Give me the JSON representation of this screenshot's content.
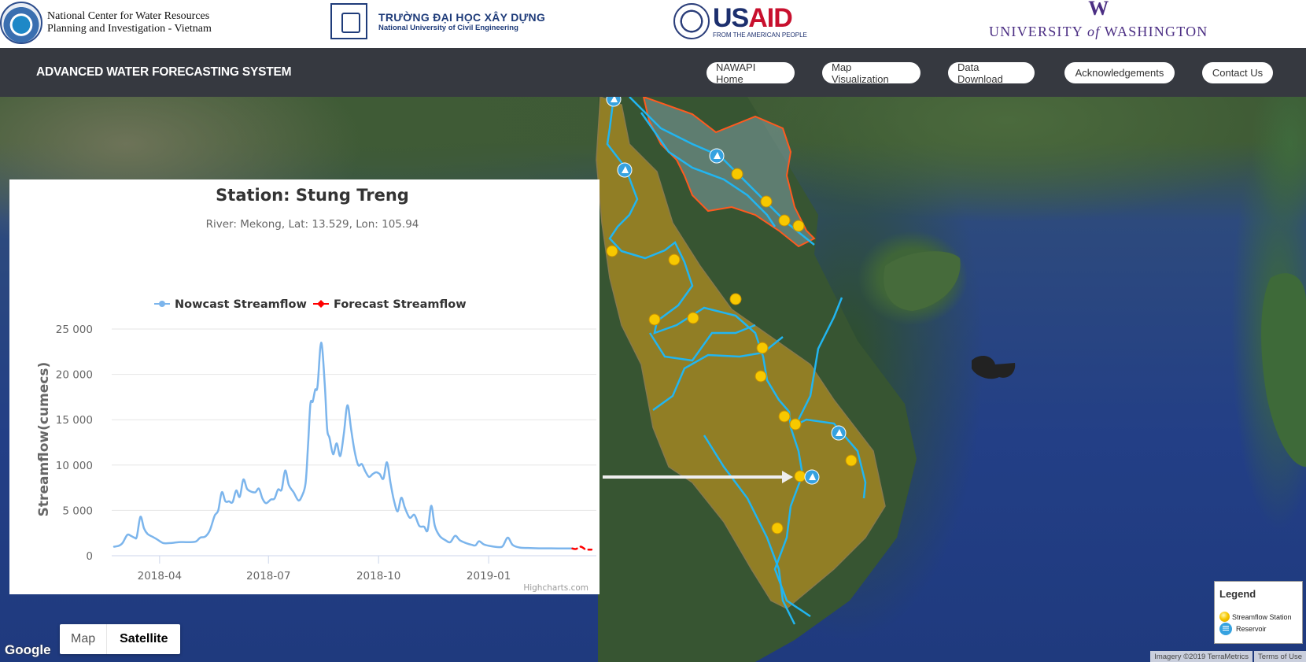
{
  "logos": {
    "nawapi": {
      "line1": "National Center for Water Resources",
      "line2": "Planning and Investigation - Vietnam"
    },
    "nuce": {
      "vn": "TRƯỜNG ĐẠI HỌC XÂY DỰNG",
      "en": "National University of Civil Engineering"
    },
    "usaid": {
      "us": "US",
      "aid": "AID",
      "tagline": "FROM THE AMERICAN PEOPLE"
    },
    "uw": {
      "mark": "W",
      "pre": "UNIVERSITY ",
      "of": "of",
      "post": " WASHINGTON"
    }
  },
  "navbar": {
    "title": "ADVANCED WATER FORECASTING SYSTEM",
    "links": [
      "NAWAPI Home",
      "Map Visualization",
      "Data Download",
      "Acknowledgements",
      "Contact Us"
    ]
  },
  "map": {
    "type_buttons": {
      "map": "Map",
      "satellite": "Satellite",
      "selected": "Satellite"
    },
    "google_label": "Google",
    "attribution": "Imagery ©2019 TerraMetrics",
    "terms": "Terms of Use",
    "legend": {
      "title": "Legend",
      "items": [
        {
          "icon": "streamflow-station-icon",
          "label": "Streamflow Station"
        },
        {
          "icon": "reservoir-icon",
          "label": "Reservoir"
        }
      ]
    },
    "colors": {
      "basin_fill": "#b8901f",
      "basin_outline": "#ff5a1f",
      "river": "#22b5f0",
      "station": "#f7c800",
      "reservoir": "#36a2e0"
    },
    "selected_station": "Stung Treng"
  },
  "chart_data": {
    "type": "line",
    "title": "Station: Stung Treng",
    "subtitle": "River: Mekong, Lat: 13.529, Lon: 105.94",
    "xlabel": "",
    "ylabel": "Streamflow(cumecs)",
    "ylim": [
      0,
      25000
    ],
    "yticks": [
      0,
      5000,
      10000,
      15000,
      20000,
      25000
    ],
    "ytick_labels": [
      "0",
      "5 000",
      "10 000",
      "15 000",
      "20 000",
      "25 000"
    ],
    "xlim": [
      "2018-02-20",
      "2019-04-01"
    ],
    "xticks": [
      "2018-04-01",
      "2018-07-01",
      "2018-10-01",
      "2019-01-01"
    ],
    "xtick_labels": [
      "2018-04",
      "2018-07",
      "2018-10",
      "2019-01"
    ],
    "grid": true,
    "legend_position": "top",
    "credits": "Highcharts.com",
    "series": [
      {
        "name": "Nowcast Streamflow",
        "color": "#7cb5ec",
        "dash": "solid",
        "points": [
          [
            "2018-02-22",
            1000
          ],
          [
            "2018-02-26",
            1100
          ],
          [
            "2018-03-01",
            1400
          ],
          [
            "2018-03-05",
            2300
          ],
          [
            "2018-03-08",
            2200
          ],
          [
            "2018-03-11",
            2000
          ],
          [
            "2018-03-13",
            2100
          ],
          [
            "2018-03-16",
            4300
          ],
          [
            "2018-03-19",
            3000
          ],
          [
            "2018-03-22",
            2400
          ],
          [
            "2018-03-26",
            2100
          ],
          [
            "2018-03-30",
            1800
          ],
          [
            "2018-04-04",
            1400
          ],
          [
            "2018-04-10",
            1400
          ],
          [
            "2018-04-17",
            1500
          ],
          [
            "2018-04-24",
            1500
          ],
          [
            "2018-05-01",
            1550
          ],
          [
            "2018-05-05",
            2000
          ],
          [
            "2018-05-09",
            2100
          ],
          [
            "2018-05-13",
            2800
          ],
          [
            "2018-05-17",
            4400
          ],
          [
            "2018-05-20",
            5000
          ],
          [
            "2018-05-23",
            7000
          ],
          [
            "2018-05-26",
            6000
          ],
          [
            "2018-05-29",
            6000
          ],
          [
            "2018-06-01",
            5900
          ],
          [
            "2018-06-04",
            7200
          ],
          [
            "2018-06-07",
            6500
          ],
          [
            "2018-06-10",
            8400
          ],
          [
            "2018-06-13",
            7400
          ],
          [
            "2018-06-16",
            7100
          ],
          [
            "2018-06-20",
            7000
          ],
          [
            "2018-06-23",
            7400
          ],
          [
            "2018-06-26",
            6300
          ],
          [
            "2018-06-29",
            5800
          ],
          [
            "2018-07-03",
            6200
          ],
          [
            "2018-07-06",
            6300
          ],
          [
            "2018-07-09",
            7300
          ],
          [
            "2018-07-12",
            7300
          ],
          [
            "2018-07-15",
            9400
          ],
          [
            "2018-07-18",
            7800
          ],
          [
            "2018-07-22",
            7000
          ],
          [
            "2018-07-26",
            6100
          ],
          [
            "2018-07-29",
            6600
          ],
          [
            "2018-08-01",
            8000
          ],
          [
            "2018-08-03",
            12000
          ],
          [
            "2018-08-05",
            16700
          ],
          [
            "2018-08-07",
            17000
          ],
          [
            "2018-08-09",
            18300
          ],
          [
            "2018-08-11",
            18700
          ],
          [
            "2018-08-14",
            23500
          ],
          [
            "2018-08-17",
            19000
          ],
          [
            "2018-08-19",
            14000
          ],
          [
            "2018-08-21",
            13000
          ],
          [
            "2018-08-24",
            11200
          ],
          [
            "2018-08-27",
            12400
          ],
          [
            "2018-08-30",
            11000
          ],
          [
            "2018-09-02",
            13500
          ],
          [
            "2018-09-05",
            16600
          ],
          [
            "2018-09-08",
            14000
          ],
          [
            "2018-09-11",
            11500
          ],
          [
            "2018-09-14",
            10000
          ],
          [
            "2018-09-17",
            10100
          ],
          [
            "2018-09-20",
            9300
          ],
          [
            "2018-09-23",
            8700
          ],
          [
            "2018-09-26",
            9000
          ],
          [
            "2018-09-29",
            9200
          ],
          [
            "2018-10-02",
            9000
          ],
          [
            "2018-10-05",
            8500
          ],
          [
            "2018-10-08",
            10300
          ],
          [
            "2018-10-11",
            8000
          ],
          [
            "2018-10-14",
            6000
          ],
          [
            "2018-10-17",
            4900
          ],
          [
            "2018-10-20",
            6400
          ],
          [
            "2018-10-23",
            5300
          ],
          [
            "2018-10-27",
            4200
          ],
          [
            "2018-10-31",
            4500
          ],
          [
            "2018-11-04",
            3300
          ],
          [
            "2018-11-08",
            3200
          ],
          [
            "2018-11-11",
            2800
          ],
          [
            "2018-11-14",
            5500
          ],
          [
            "2018-11-17",
            3300
          ],
          [
            "2018-11-21",
            2200
          ],
          [
            "2018-11-26",
            1700
          ],
          [
            "2018-11-30",
            1500
          ],
          [
            "2018-12-04",
            2200
          ],
          [
            "2018-12-08",
            1700
          ],
          [
            "2018-12-13",
            1400
          ],
          [
            "2018-12-18",
            1200
          ],
          [
            "2018-12-21",
            1150
          ],
          [
            "2018-12-24",
            1600
          ],
          [
            "2018-12-28",
            1250
          ],
          [
            "2019-01-03",
            1050
          ],
          [
            "2019-01-10",
            950
          ],
          [
            "2019-01-13",
            1100
          ],
          [
            "2019-01-17",
            2000
          ],
          [
            "2019-01-21",
            1200
          ],
          [
            "2019-01-27",
            900
          ],
          [
            "2019-02-05",
            850
          ],
          [
            "2019-02-15",
            820
          ],
          [
            "2019-02-28",
            800
          ],
          [
            "2019-03-12",
            800
          ]
        ]
      },
      {
        "name": "Forecast Streamflow",
        "color": "#ff0000",
        "dash": "dash",
        "points": [
          [
            "2019-03-12",
            800
          ],
          [
            "2019-03-15",
            750
          ],
          [
            "2019-03-19",
            1000
          ],
          [
            "2019-03-23",
            700
          ],
          [
            "2019-03-28",
            680
          ]
        ]
      }
    ]
  }
}
